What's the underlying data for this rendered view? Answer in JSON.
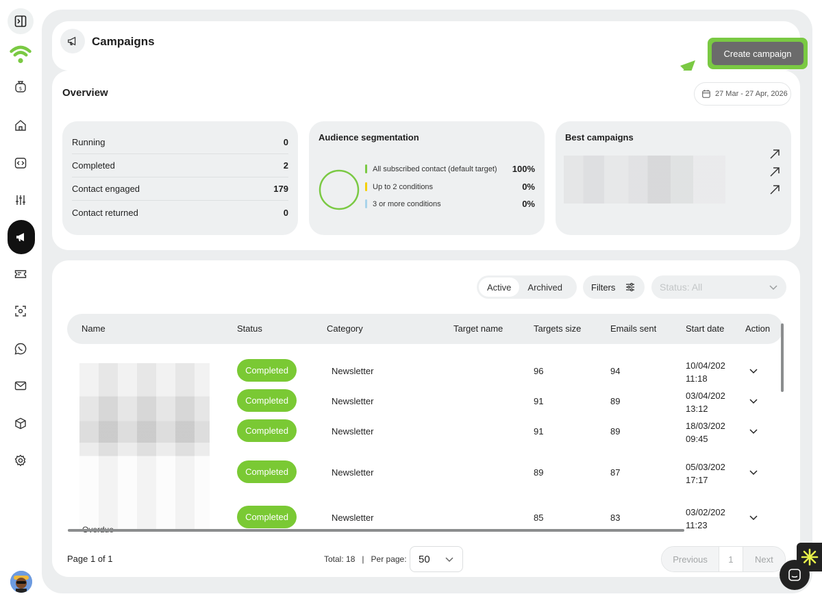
{
  "sidebar": {
    "items": [
      {
        "icon": "sidebar-toggle-icon"
      },
      {
        "icon": "wifi-logo-icon"
      },
      {
        "icon": "money-bag-icon"
      },
      {
        "icon": "home-icon"
      },
      {
        "icon": "code-icon"
      },
      {
        "icon": "sliders-icon"
      },
      {
        "icon": "megaphone-icon",
        "active": true
      },
      {
        "icon": "ticket-icon"
      },
      {
        "icon": "scan-icon"
      },
      {
        "icon": "whatsapp-icon"
      },
      {
        "icon": "mail-icon"
      },
      {
        "icon": "cube-icon"
      },
      {
        "icon": "settings-icon"
      }
    ]
  },
  "header": {
    "title": "Campaigns",
    "create_label": "Create campaign"
  },
  "overview": {
    "title": "Overview",
    "date_range": "27 Mar - 27 Apr, 2026",
    "stats": [
      {
        "label": "Running",
        "value": "0"
      },
      {
        "label": "Completed",
        "value": "2"
      },
      {
        "label": "Contact engaged",
        "value": "179"
      },
      {
        "label": "Contact returned",
        "value": "0"
      }
    ],
    "segmentation": {
      "title": "Audience segmentation",
      "rows": [
        {
          "label": "All subscribed contact (default target)",
          "value": "100%",
          "color": "#7ac943"
        },
        {
          "label": "Up to 2 conditions",
          "value": "0%",
          "color": "#f5d000"
        },
        {
          "label": "3 or more conditions",
          "value": "0%",
          "color": "#a9d3ea"
        }
      ]
    },
    "best": {
      "title": "Best campaigns"
    }
  },
  "table": {
    "toggle": {
      "active": "Active",
      "archived": "Archived"
    },
    "filters_label": "Filters",
    "status_placeholder": "Status: All",
    "columns": [
      "Name",
      "Status",
      "Category",
      "Target name",
      "Targets size",
      "Emails sent",
      "Start date",
      "Action"
    ],
    "rows": [
      {
        "status": "Completed",
        "category": "Newsletter",
        "target_name": "",
        "targets_size": "96",
        "emails_sent": "94",
        "date": "10/04/202",
        "time": "11:18"
      },
      {
        "status": "Completed",
        "category": "Newsletter",
        "target_name": "",
        "targets_size": "91",
        "emails_sent": "89",
        "date": "03/04/202",
        "time": "13:12"
      },
      {
        "status": "Completed",
        "category": "Newsletter",
        "target_name": "",
        "targets_size": "91",
        "emails_sent": "89",
        "date": "18/03/202",
        "time": "09:45"
      },
      {
        "status": "Completed",
        "category": "Newsletter",
        "target_name": "",
        "targets_size": "89",
        "emails_sent": "87",
        "date": "05/03/202",
        "time": "17:17"
      },
      {
        "status": "Completed",
        "category": "Newsletter",
        "target_name": "",
        "targets_size": "85",
        "emails_sent": "83",
        "date": "03/02/202",
        "time": "11:23"
      }
    ],
    "overdue_label": "Overdue"
  },
  "footer": {
    "page_label": "Page 1 of 1",
    "total_label": "Total: 18",
    "separator": "|",
    "per_page_label": "Per page:",
    "per_page_value": "50",
    "prev_label": "Previous",
    "page_num": "1",
    "next_label": "Next"
  },
  "colors": {
    "accent_green": "#7ac943",
    "badge_green": "#7ac934",
    "dark": "#111111"
  }
}
